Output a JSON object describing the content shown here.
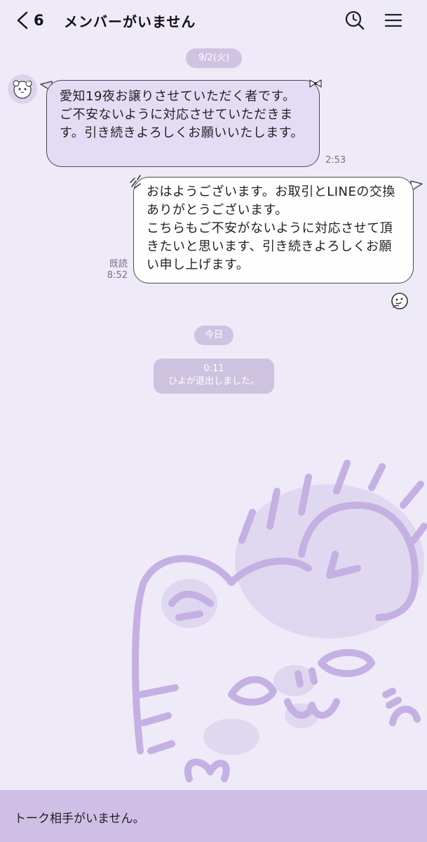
{
  "header": {
    "back_count": "6",
    "title": "メンバーがいません",
    "icons": [
      "chevron-left-icon",
      "search-icon",
      "menu-icon"
    ]
  },
  "chat": {
    "date_divider_1": "9/2(火)",
    "incoming": {
      "text": "愛知19夜お譲りさせていただく者です。ご不安ないように対応させていただきます。引き続きよろしくお願いいたします。",
      "time": "2:53"
    },
    "outgoing": {
      "text": "おはようございます。お取引とLINEの交換ありがとうございます。\nこちらもご不安がないように対応させて頂きたいと思います、引き続きよろしくお願い申し上げます。",
      "read": "既読",
      "time": "8:52"
    },
    "date_divider_2": "今日",
    "system": {
      "time": "0:11",
      "text": "ひよが退出しました。"
    }
  },
  "footer": {
    "notice": "トーク相手がいません。"
  },
  "colors": {
    "background": "#efeaf8",
    "incoming_bubble": "#e4dcf5",
    "outgoing_bubble": "#fffefe",
    "pill": "#cfc3e3",
    "footer": "#cfbfe6",
    "art": "#c9b6e4"
  }
}
